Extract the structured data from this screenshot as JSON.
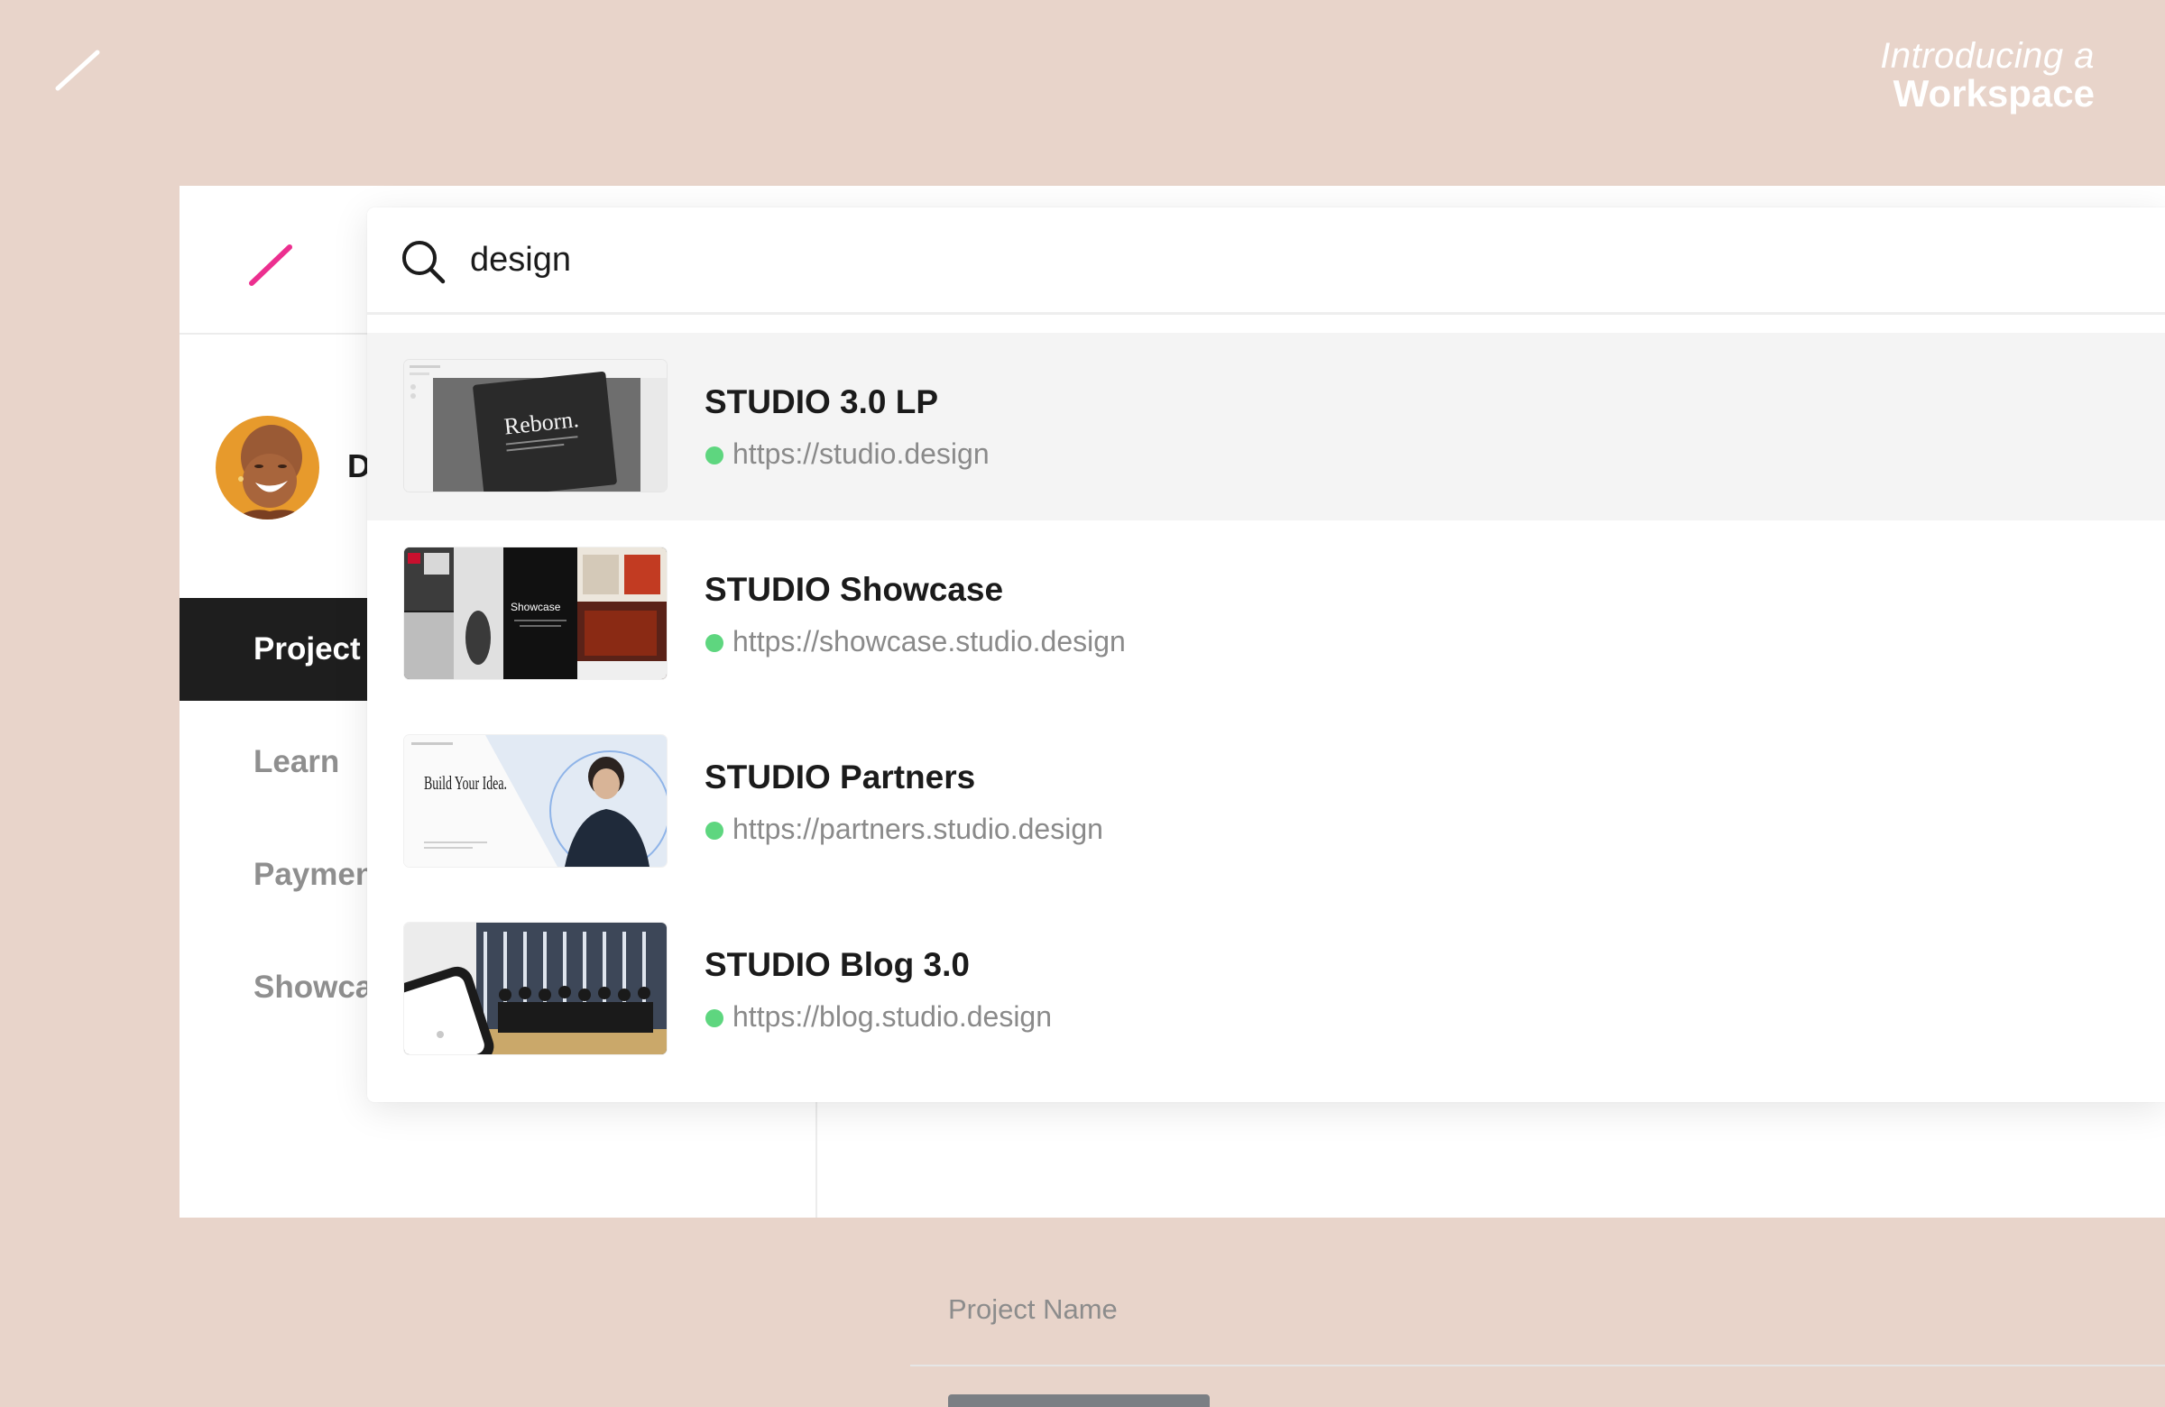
{
  "tagline": {
    "intro": "Introducing a",
    "main": "Workspace"
  },
  "search": {
    "query": "design"
  },
  "user": {
    "initial": "D"
  },
  "sidebar": {
    "items": [
      {
        "label": "Project",
        "active": true
      },
      {
        "label": "Learn",
        "active": false
      },
      {
        "label": "Payment",
        "active": false
      },
      {
        "label": "Showcase",
        "active": false
      }
    ]
  },
  "projects_table": {
    "column_name": "Project Name"
  },
  "results": [
    {
      "title": "STUDIO 3.0 LP",
      "url": "https://studio.design",
      "thumbnail": "reborn-page",
      "thumbnail_text": "Reborn."
    },
    {
      "title": "STUDIO Showcase",
      "url": "https://showcase.studio.design",
      "thumbnail": "showcase-collage",
      "thumbnail_text": "Showcase"
    },
    {
      "title": "STUDIO Partners",
      "url": "https://partners.studio.design",
      "thumbnail": "partners-page",
      "thumbnail_text": "Build Your Idea."
    },
    {
      "title": "STUDIO Blog 3.0",
      "url": "https://blog.studio.design",
      "thumbnail": "blog-phone-group",
      "thumbnail_text": ""
    }
  ],
  "colors": {
    "background": "#e8d4ca",
    "brand_slash": "#ec2f8f",
    "status_online": "#5ed67f",
    "active_nav": "#1e1e1e",
    "selected_row": "#f4f4f4"
  },
  "icons": {
    "top_logo": "slash-logo-icon",
    "app_logo": "slash-logo-icon",
    "search": "search-icon"
  }
}
